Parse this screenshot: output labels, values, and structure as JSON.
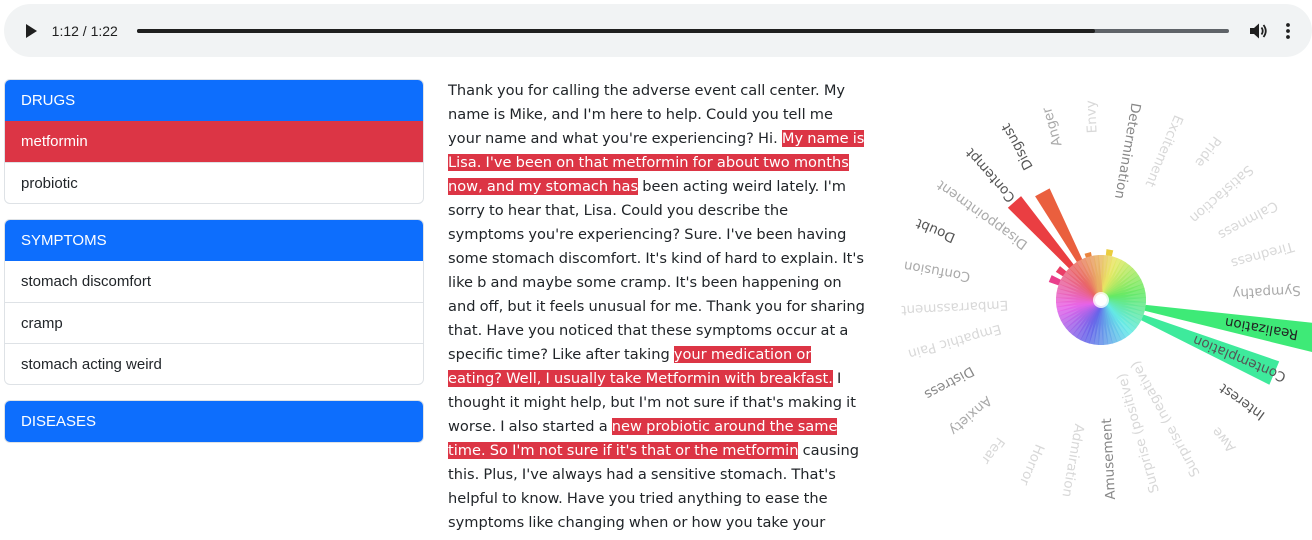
{
  "player": {
    "time": "1:12 / 1:22",
    "progress": 0.878,
    "play_icon": "play-icon",
    "volume_icon": "volume-icon",
    "more_icon": "more-vert-icon"
  },
  "drugs": {
    "title": "DRUGS",
    "items": [
      {
        "label": "metformin",
        "active": true
      },
      {
        "label": "probiotic",
        "active": false
      }
    ]
  },
  "symptoms": {
    "title": "SYMPTOMS",
    "items": [
      {
        "label": "stomach discomfort"
      },
      {
        "label": "cramp"
      },
      {
        "label": "stomach acting weird"
      }
    ]
  },
  "diseases": {
    "title": "DISEASES"
  },
  "colors": {
    "primary": "#0d6efd",
    "highlight": "#dc3545"
  },
  "transcript": {
    "segments": [
      {
        "text": "Thank you for calling the adverse event call center. My name is Mike, and I'm here to help. Could you tell me your name and what you're experiencing? Hi. ",
        "highlight": false
      },
      {
        "text": "My name is Lisa. I've been on that metformin for about two months now, and my stomach has",
        "highlight": true
      },
      {
        "text": " been acting weird lately. I'm sorry to hear that, Lisa. Could you describe the symptoms you're experiencing? Sure. I've been having some stomach discomfort. It's kind of hard to explain. It's like b and maybe some cramp. It's been happening on and off, but it feels unusual for me. Thank you for sharing that. Have you noticed that these symptoms occur at a specific time? Like after taking ",
        "highlight": false
      },
      {
        "text": "your medication or eating? Well, I usually take Metformin with breakfast.",
        "highlight": true
      },
      {
        "text": " I thought it might help, but I'm not sure if that's making it worse. I also started a ",
        "highlight": false
      },
      {
        "text": "new probiotic around the same time. So I'm not sure if it's that or the metformin",
        "highlight": true
      },
      {
        "text": " causing this. Plus, I've always had a sensitive stomach. That's helpful to know. Have you tried anything to ease the symptoms like changing when or how you take your medication? I've been trying to stick to",
        "highlight": false
      }
    ]
  },
  "emotion_wheel": {
    "emotions": [
      {
        "label": "Confusion",
        "value": 0.0,
        "level": "light"
      },
      {
        "label": "Doubt",
        "value": 0.05,
        "level": "dark"
      },
      {
        "label": "Disappointment",
        "value": 0.04,
        "level": "light"
      },
      {
        "label": "Contempt",
        "value": 0.42,
        "level": "dark"
      },
      {
        "label": "Disgust",
        "value": 0.38,
        "level": "dark"
      },
      {
        "label": "Anger",
        "value": 0.02,
        "level": "light"
      },
      {
        "label": "Envy",
        "value": 0.0,
        "level": "faint"
      },
      {
        "label": "Determination",
        "value": 0.03,
        "level": "medium"
      },
      {
        "label": "Excitement",
        "value": 0.0,
        "level": "faint"
      },
      {
        "label": "Pride",
        "value": 0.0,
        "level": "faint"
      },
      {
        "label": "Satisfaction",
        "value": 0.0,
        "level": "faint"
      },
      {
        "label": "Calmness",
        "value": 0.0,
        "level": "faint"
      },
      {
        "label": "Tiredness",
        "value": 0.0,
        "level": "faint"
      },
      {
        "label": "Sympathy",
        "value": 0.0,
        "level": "light"
      },
      {
        "label": "Realization",
        "value": 0.93,
        "level": "black"
      },
      {
        "label": "Contemplation",
        "value": 0.7,
        "level": "dark"
      },
      {
        "label": "Interest",
        "value": 0.0,
        "level": "dark"
      },
      {
        "label": "Awe",
        "value": 0.0,
        "level": "faint"
      },
      {
        "label": "Surprise (negative)",
        "value": 0.0,
        "level": "faint"
      },
      {
        "label": "Surprise (positive)",
        "value": 0.0,
        "level": "faint"
      },
      {
        "label": "Amusement",
        "value": 0.0,
        "level": "medium"
      },
      {
        "label": "Admiration",
        "value": 0.0,
        "level": "faint"
      },
      {
        "label": "Horror",
        "value": 0.0,
        "level": "faint"
      },
      {
        "label": "Fear",
        "value": 0.0,
        "level": "faint"
      },
      {
        "label": "Anxiety",
        "value": 0.0,
        "level": "light"
      },
      {
        "label": "Distress",
        "value": 0.0,
        "level": "medium"
      },
      {
        "label": "Empathic Pain",
        "value": 0.0,
        "level": "faint"
      },
      {
        "label": "Embarrassment",
        "value": 0.0,
        "level": "faint"
      }
    ]
  }
}
